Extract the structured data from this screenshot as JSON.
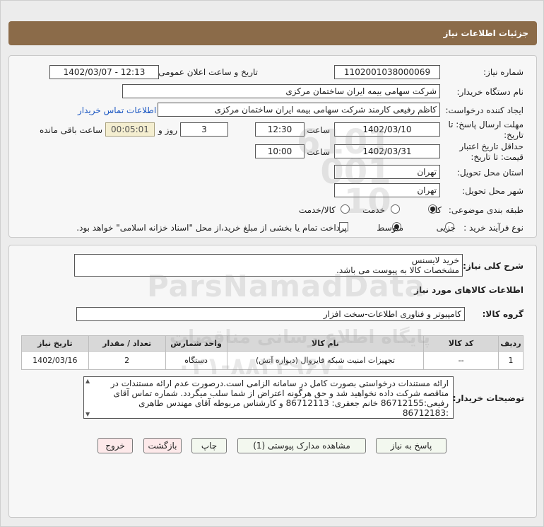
{
  "page": {
    "title": "جزئیات اطلاعات نیاز"
  },
  "labels": {
    "need_number": "شماره نیاز:",
    "announce_datetime": "تاریخ و ساعت اعلان عمومی:",
    "buyer_org": "نام دستگاه خریدار:",
    "requester": "ایجاد کننده درخواست:",
    "send_deadline": "مهلت ارسال پاسخ: تا تاریخ:",
    "time": "ساعت",
    "day_and": "روز و",
    "remaining": "ساعت باقی مانده",
    "price_validity": "حداقل تاریخ اعتبار قیمت: تا تاریخ:",
    "province": "استان محل تحویل:",
    "city": "شهر محل تحویل:",
    "category": "طبقه بندی موضوعی:",
    "purchase_type": "نوع فرآیند خرید :",
    "need_summary": "شرح کلی نیاز:",
    "goods_info": "اطلاعات کالاهای مورد نیاز",
    "goods_group": "گروه کالا:",
    "buyer_notes": "توضیحات خریدار:"
  },
  "fields": {
    "need_number": "1102001038000069",
    "announce_datetime": "1402/03/07 - 12:13",
    "buyer_org": "شرکت سهامی بیمه ایران ساختمان مرکزی",
    "requester": "کاظم رفیعی کارمند شرکت سهامی بیمه ایران ساختمان مرکزی",
    "contact_link": "اطلاعات تماس خریدار",
    "send_date": "1402/03/10",
    "send_time": "12:30",
    "days": "3",
    "remaining_time": "00:05:01",
    "validity_date": "1402/03/31",
    "validity_time": "10:00",
    "province": "تهران",
    "city": "تهران"
  },
  "category_options": [
    {
      "label": "کالا",
      "selected": true
    },
    {
      "label": "خدمت",
      "selected": false
    },
    {
      "label": "کالا/خدمت",
      "selected": false
    }
  ],
  "purchase_options": [
    {
      "label": "جزیی",
      "selected": false
    },
    {
      "label": "متوسط",
      "selected": true
    }
  ],
  "treasury_note": "پرداخت تمام یا بخشی از مبلغ خرید،از محل \"اسناد خزانه اسلامی\" خواهد بود.",
  "need_summary": {
    "line1": "خرید لایسنس",
    "line2": "مشخصات کالا به پیوست می باشد."
  },
  "goods_group": "کامپیوتر و فناوری اطلاعات-سخت افزار",
  "table": {
    "headers": [
      "ردیف",
      "کد کالا",
      "نام کالا",
      "واحد شمارش",
      "تعداد / مقدار",
      "تاریخ نیاز"
    ],
    "rows": [
      [
        "1",
        "--",
        "تجهیزات امنیت شبکه فایروال (دیواره آتش)",
        "دستگاه",
        "2",
        "1402/03/16"
      ]
    ]
  },
  "buyer_notes": "ارائه مستندات درخواستی بصورت کامل در سامانه الزامی است.درصورت عدم ارائه مستندات در مناقصه شرکت داده نخواهید شد و حق هرگونه اعتراض از شما سلب میگردد. شماره تماس آقای رفیعی:86712155  خانم جعفری: 86712113 و کارشناس مربوطه آقای مهندس طاهری :86712183",
  "buttons": {
    "reply": "پاسخ به نیاز",
    "attachments": "مشاهده مدارک پیوستی (1)",
    "print": "چاپ",
    "back": "بازگشت",
    "exit": "خروج"
  },
  "watermark": {
    "brand": "ParsNamadData",
    "line1": "پایگاه اطلاع رسانی مناقصات",
    "line2": "۰۲۱-۸۸۳۴۹۶۷۰",
    "big_number": "6101\n001\n10"
  },
  "colors": {
    "title_bar": "#8b6b49",
    "link": "#1b57c2",
    "remaining_bg": "#f4eed0",
    "button_green": "#f3f8ef",
    "button_pink": "#fde9ea"
  }
}
